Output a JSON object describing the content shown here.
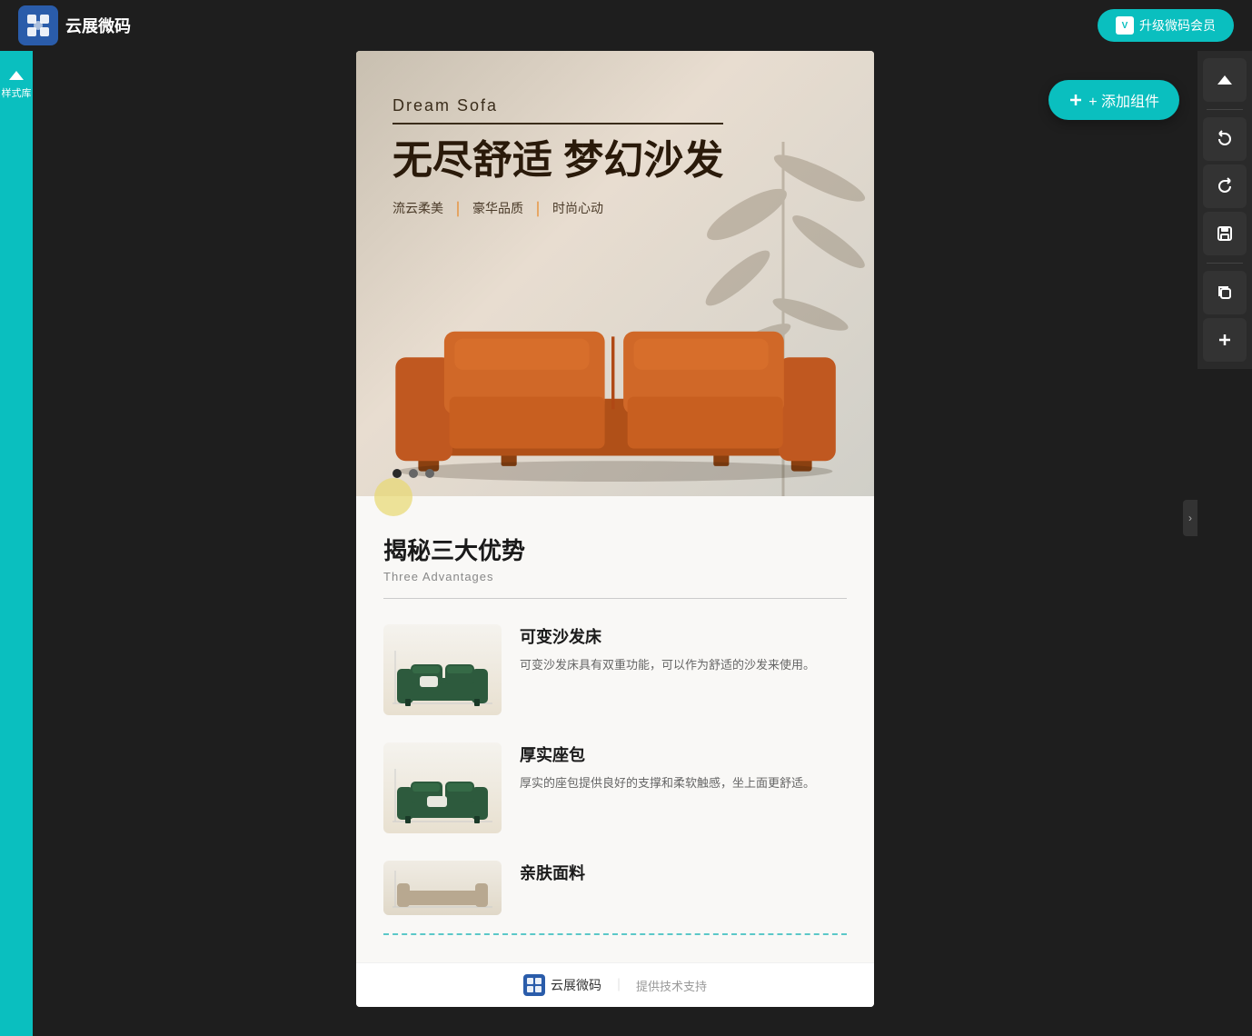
{
  "app": {
    "logo_text": "云展微码",
    "upgrade_btn": "升级微码会员"
  },
  "left_sidebar": {
    "items": [
      {
        "label": "样式库"
      }
    ]
  },
  "toolbar": {
    "undo_label": "↺",
    "redo_label": "↻",
    "save_label": "💾",
    "copy_label": "⧉",
    "add_label": "＋",
    "add_component_label": "+ 添加组件"
  },
  "hero": {
    "subtitle": "Dream Sofa",
    "title_cn": "无尽舒适 梦幻沙发",
    "tags": [
      "流云柔美",
      "豪华品质",
      "时尚心动"
    ],
    "tag_separator": "｜",
    "dots": [
      {
        "active": true
      },
      {
        "active": false
      },
      {
        "active": false
      }
    ]
  },
  "advantages": {
    "title_cn": "揭秘三大优势",
    "title_en": "Three Advantages",
    "items": [
      {
        "title": "可变沙发床",
        "desc": "可变沙发床具有双重功能，可以作为舒适的沙发来使用。"
      },
      {
        "title": "厚实座包",
        "desc": "厚实的座包提供良好的支撑和柔软触感，坐上面更舒适。"
      },
      {
        "title": "亲肤面料",
        "desc": ""
      }
    ]
  },
  "footer": {
    "logo_text": "云展微码",
    "separator": "｜",
    "support_text": "提供技术支持"
  },
  "colors": {
    "teal": "#0abfbf",
    "dark_bg": "#1e1e1e",
    "orange_sofa": "#c06020",
    "green_sofa": "#2d5a3d",
    "gold_badge": "#e8d870"
  }
}
